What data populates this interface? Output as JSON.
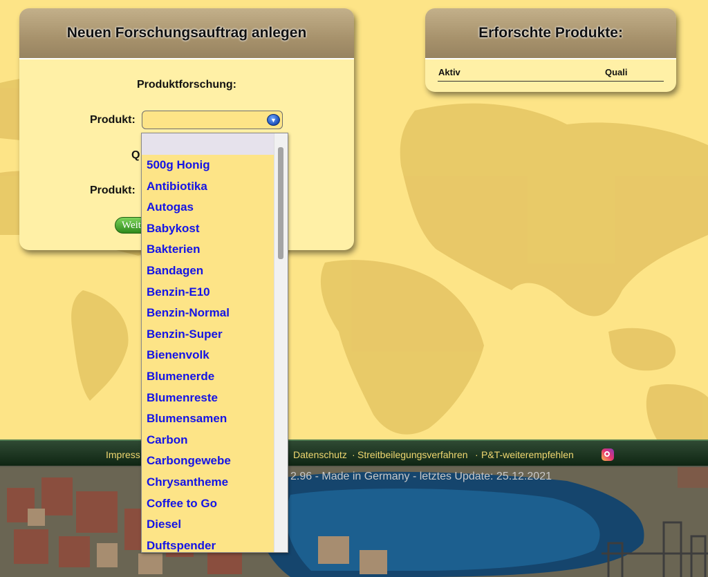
{
  "research_panel": {
    "title": "Neuen Forschungsauftrag anlegen",
    "section": "Produktforschung:",
    "label_produkt": "Produkt:",
    "label_q": "Q",
    "label_produkt2": "Produkt:",
    "button": "Weiter"
  },
  "researched_panel": {
    "title": "Erforschte Produkte:",
    "columns": [
      "Aktiv",
      "Quali"
    ]
  },
  "dropdown": {
    "selected": "",
    "options": [
      "500g Honig",
      "Antibiotika",
      "Autogas",
      "Babykost",
      "Bakterien",
      "Bandagen",
      "Benzin-E10",
      "Benzin-Normal",
      "Benzin-Super",
      "Bienenvolk",
      "Blumenerde",
      "Blumenreste",
      "Blumensamen",
      "Carbon",
      "Carbongewebe",
      "Chrysantheme",
      "Coffee to Go",
      "Diesel",
      "Duftspender"
    ]
  },
  "footer": {
    "links": [
      "Impress",
      "Datenschutz",
      "Streitbeilegungsverfahren",
      "P&T-weiterempfehlen"
    ],
    "separator": "·",
    "version_text": "2.96 - Made in Germany - letztes Update: 25.12.2021"
  },
  "colors": {
    "page_background": "#fde487",
    "panel_header": "#a7926c",
    "link_blue": "#1414e6",
    "footer_link": "#f0d870"
  }
}
